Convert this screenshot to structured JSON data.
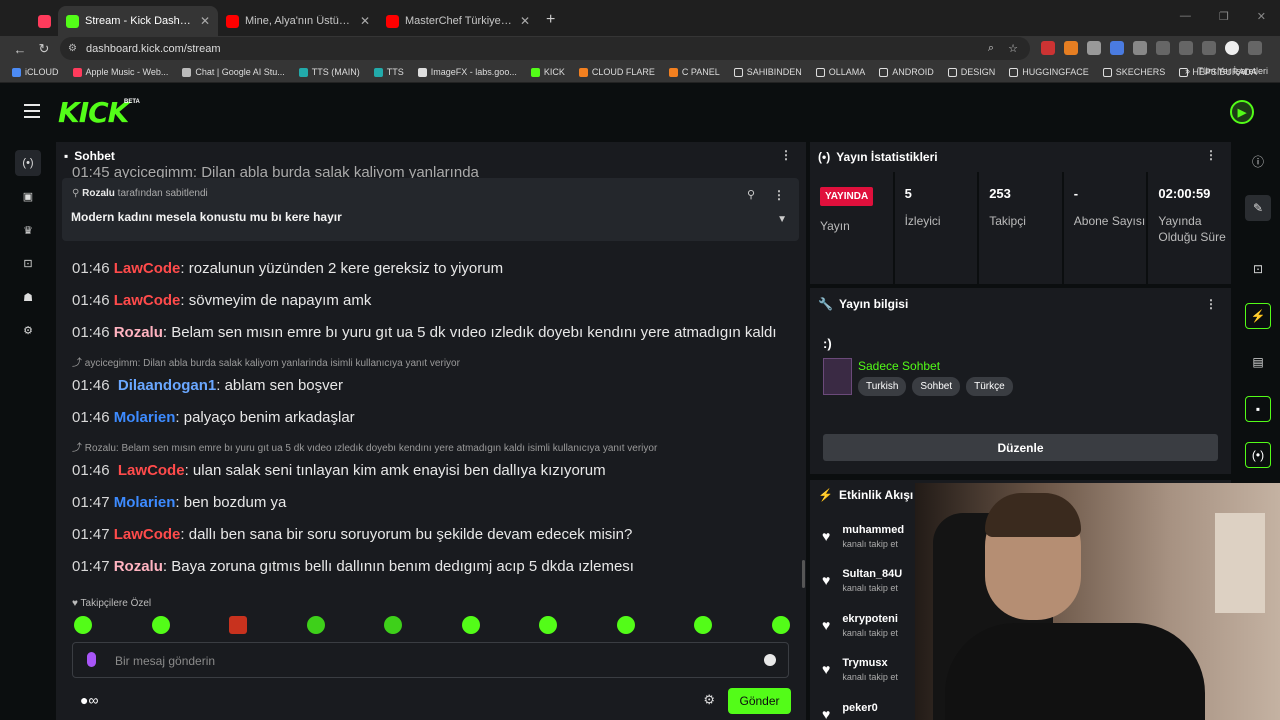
{
  "browser": {
    "tabs": [
      {
        "title": "",
        "color": "#ff3b5c"
      },
      {
        "title": "Stream - Kick Dashboard",
        "color": "#53fc18",
        "active": true
      },
      {
        "title": "Mine, Alya'nın Üstüne Araba Sü...",
        "color": "#ff0000"
      },
      {
        "title": "MasterChef Türkiye - YouTube",
        "color": "#ff0000"
      }
    ],
    "url": "dashboard.kick.com/stream",
    "bookmarks": [
      "iCLOUD",
      "Apple Music - Web...",
      "Chat | Google AI Stu...",
      "TTS (MAIN)",
      "TTS",
      "ImageFX - labs.goo...",
      "KICK",
      "CLOUD FLARE",
      "C PANEL",
      "SAHIBINDEN",
      "OLLAMA",
      "ANDROID",
      "DESIGN",
      "HUGGINGFACE",
      "SKECHERS",
      "HEPSIBURADA"
    ],
    "bookmarks_all": "Tüm Yer İşaretleri"
  },
  "app": {
    "logo": "KICK",
    "beta": "BETA"
  },
  "chat": {
    "title": "Sohbet",
    "old_line": "01:45  aycicegimm: Dilan abla burda salak kaliyom yanlarında",
    "pinned": {
      "user": "Rozalu",
      "by_suffix": " tarafından sabitlendi",
      "message": "Modern kadını mesela konustu mu bı kere hayır"
    },
    "messages": [
      {
        "time": "01:46",
        "user": "LawCode",
        "color": "#ff4b4b",
        "text": "rozalunun yüzünden 2 kere gereksiz to yiyorum"
      },
      {
        "time": "01:46",
        "user": "LawCode",
        "color": "#ff4b4b",
        "text": "sövmeyim de napayım amk"
      },
      {
        "time": "01:46",
        "user": "Rozalu",
        "color": "#ffb3c0",
        "text": "Belam sen mısın emre bı yuru gıt ua 5 dk vıdeo ızledık doyebı kendını yere atmadıgın kaldı"
      },
      {
        "reply": "aycicegimm: Dilan abla burda salak kaliyom yanlarinda isimli kullanıcıya yanıt veriyor"
      },
      {
        "time": "01:46",
        "user": "Dilaandogan1",
        "color": "#6aa7ff",
        "text": "ablam sen boşver"
      },
      {
        "time": "01:46",
        "user": "Molarien",
        "color": "#3d8bff",
        "text": "palyaço benim arkadaşlar"
      },
      {
        "reply": "Rozalu: Belam sen mısın emre bı yuru gıt ua 5 dk vıdeo ızledık doyebı kendını yere atmadıgın kaldı isimli kullanıcıya yanıt veriyor"
      },
      {
        "time": "01:46",
        "user": "LawCode",
        "color": "#ff4b4b",
        "text": "ulan salak seni tınlayan kim amk enayisi ben dallıya kızıyorum"
      },
      {
        "time": "01:47",
        "user": "Molarien",
        "color": "#3d8bff",
        "text": "ben bozdum ya"
      },
      {
        "time": "01:47",
        "user": "LawCode",
        "color": "#ff4b4b",
        "text": "dallı ben sana bir soru soruyorum bu şekilde devam edecek misin?"
      },
      {
        "time": "01:47",
        "user": "Rozalu",
        "color": "#ffb3c0",
        "text": "Baya zoruna gıtmıs bellı dallının benım dedıgımj acıp 5 dkda ızlemesı"
      }
    ],
    "followers_only": "Takipçilere Özel",
    "input_placeholder": "Bir mesaj gönderin",
    "send": "Gönder"
  },
  "stats": {
    "title": "Yayın İstatistikleri",
    "live_badge": "YAYINDA",
    "cells": [
      {
        "value": "",
        "label": "Yayın"
      },
      {
        "value": "5",
        "label": "İzleyici"
      },
      {
        "value": "253",
        "label": "Takipçi"
      },
      {
        "value": "-",
        "label": "Abone Sayısı"
      },
      {
        "value": "02:00:59",
        "label": "Yayında Olduğu Süre"
      }
    ]
  },
  "info": {
    "title": "Yayın bilgisi",
    "stream_title": ":)",
    "category": "Sadece Sohbet",
    "tags": [
      "Turkish",
      "Sohbet",
      "Türkçe"
    ],
    "edit": "Düzenle"
  },
  "activity": {
    "title": "Etkinlik Akışı",
    "items": [
      {
        "name": "muhammed",
        "sub": "kanalı takip et"
      },
      {
        "name": "Sultan_84U",
        "sub": "kanalı takip et"
      },
      {
        "name": "ekrypoteni",
        "sub": "kanalı takip et"
      },
      {
        "name": "Trymusx",
        "sub": "kanalı takip et"
      },
      {
        "name": "peker0",
        "sub": ""
      }
    ]
  }
}
